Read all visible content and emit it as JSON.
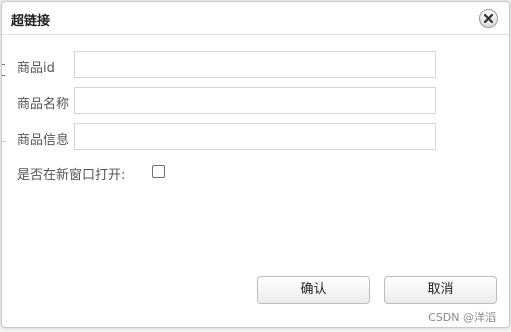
{
  "dialog": {
    "title": "超链接",
    "close_icon": "close-circle-icon"
  },
  "form": {
    "product_id_label": "商品id",
    "product_id_value": "",
    "product_name_label": "商品名称",
    "product_name_value": "",
    "product_info_label": "商品信息",
    "product_info_value": "",
    "new_window_label": "是否在新窗口打开:",
    "new_window_checked": false
  },
  "buttons": {
    "confirm_label": "确认",
    "cancel_label": "取消"
  },
  "watermark": "CSDN @洋滔"
}
